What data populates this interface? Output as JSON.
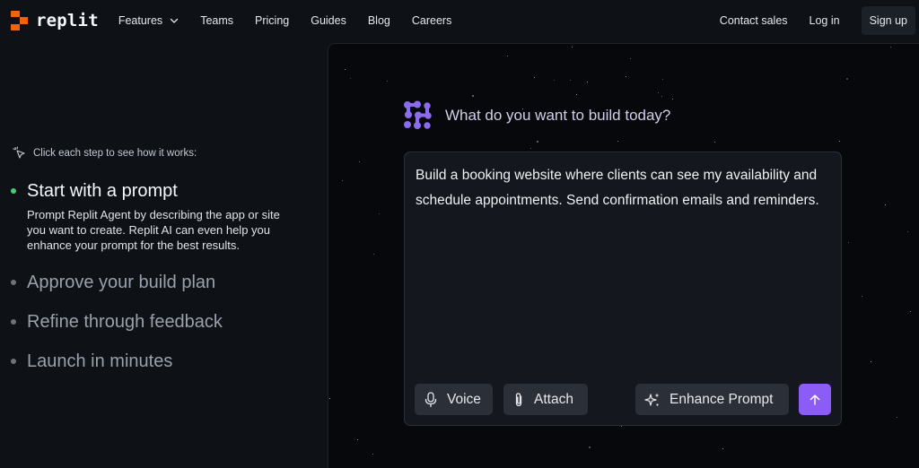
{
  "brand": {
    "name": "replit",
    "accent": "#f26207"
  },
  "nav": {
    "items": [
      {
        "label": "Features",
        "has_dropdown": true
      },
      {
        "label": "Teams"
      },
      {
        "label": "Pricing"
      },
      {
        "label": "Guides"
      },
      {
        "label": "Blog"
      },
      {
        "label": "Careers"
      }
    ],
    "contact_sales": "Contact sales",
    "login": "Log in",
    "signup": "Sign up"
  },
  "hint": {
    "icon": "cursor-click-icon",
    "text": "Click each step to see how it works:"
  },
  "steps": [
    {
      "title": "Start with a prompt",
      "description": "Prompt Replit Agent by describing the app or site you want to create. Replit AI can even help you enhance your prompt for the best results.",
      "active": true
    },
    {
      "title": "Approve your build plan",
      "active": false
    },
    {
      "title": "Refine through feedback",
      "active": false
    },
    {
      "title": "Launch in minutes",
      "active": false
    }
  ],
  "agent": {
    "icon": "replit-agent-icon",
    "question": "What do you want to build today?",
    "prompt_text": "Build a booking website where clients can see my availability and schedule appointments. Send confirmation emails and reminders.",
    "buttons": {
      "voice": "Voice",
      "attach": "Attach",
      "enhance": "Enhance Prompt"
    },
    "send_color": "#8b5cf6"
  },
  "colors": {
    "active_dot": "#3fd07b",
    "background": "#0e1116"
  }
}
